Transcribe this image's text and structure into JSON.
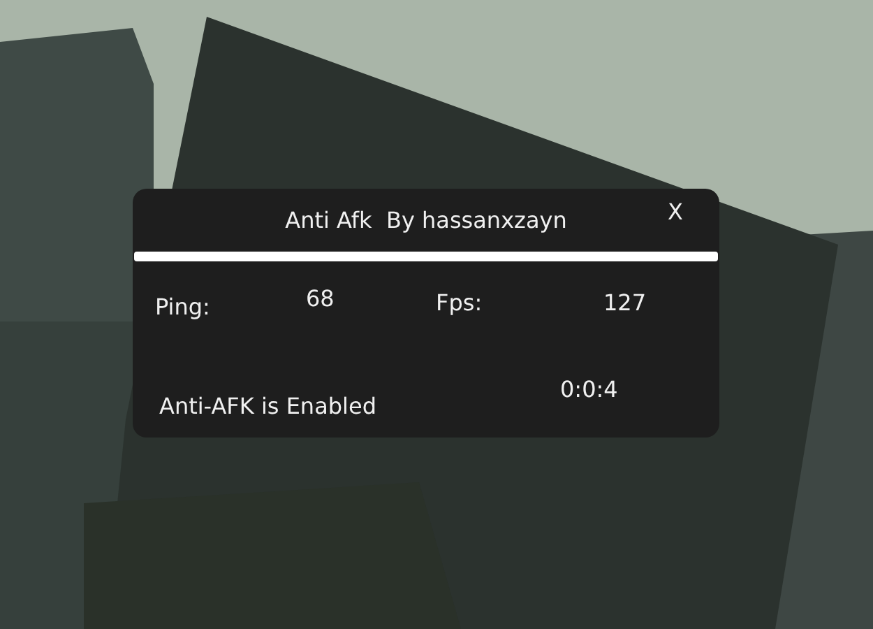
{
  "panel": {
    "title": "Anti Afk  By hassanxzayn",
    "close": "X",
    "stats": [
      {
        "label": "Ping:",
        "value": "68"
      },
      {
        "label": "Fps:",
        "value": "127"
      }
    ],
    "status": "Anti-AFK is Enabled",
    "timer": "0:0:4"
  }
}
